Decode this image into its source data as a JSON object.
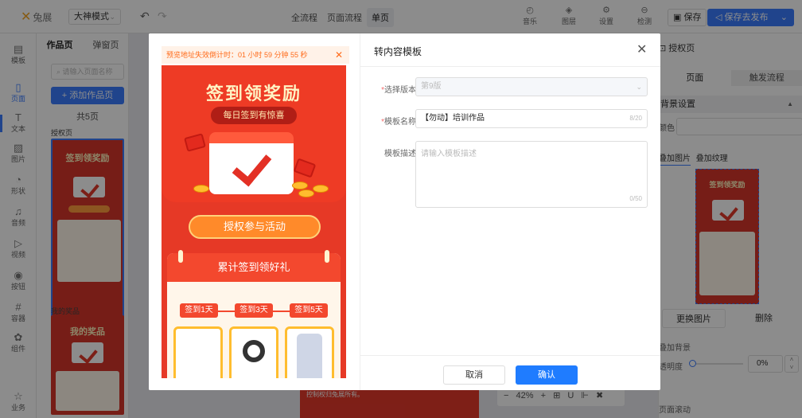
{
  "topbar": {
    "logo": "兔展",
    "mode": "大神模式",
    "flow_tabs": [
      "全流程",
      "页面流程",
      "单页"
    ],
    "tools": [
      {
        "icon": "music-icon",
        "label": "音乐"
      },
      {
        "icon": "layers-icon",
        "label": "图层"
      },
      {
        "icon": "settings-icon",
        "label": "设置"
      },
      {
        "icon": "check-icon",
        "label": "检测"
      }
    ],
    "save_label": "保存",
    "publish_label": "保存去发布"
  },
  "leftnav": {
    "items": [
      {
        "icon": "template-icon",
        "label": "模板"
      },
      {
        "icon": "page-icon",
        "label": "页面"
      },
      {
        "icon": "text-icon",
        "label": "文本"
      },
      {
        "icon": "image-icon",
        "label": "图片"
      },
      {
        "icon": "shape-icon",
        "label": "形状"
      },
      {
        "icon": "audio-icon",
        "label": "音频"
      },
      {
        "icon": "video-icon",
        "label": "视频"
      },
      {
        "icon": "button-icon",
        "label": "按钮"
      },
      {
        "icon": "container-icon",
        "label": "容器"
      },
      {
        "icon": "component-icon",
        "label": "组件"
      },
      {
        "icon": "business-icon",
        "label": "业务"
      }
    ]
  },
  "pages_panel": {
    "tabs": [
      "作品页",
      "弹窗页"
    ],
    "search_placeholder": "请输入页面名称",
    "add_label": "+ 添加作品页",
    "count": "共5页",
    "page1_label": "授权页",
    "page1_title": "签到领奖励",
    "page2_label": "我的奖品",
    "page2_title": "我的奖品"
  },
  "right_panel": {
    "title": "授权页",
    "tabs": [
      "页面",
      "触发流程"
    ],
    "section": "背景设置",
    "color_label": "颜色",
    "img_tabs": [
      "叠加图片",
      "叠加纹理"
    ],
    "preview_title": "签到领奖励",
    "replace": "更换图片",
    "delete": "删除",
    "overlay_bg": "叠加背景",
    "opacity_label": "透明度",
    "opacity": "0%",
    "page_scroll": "页面滚动"
  },
  "canvas": {
    "zoom": "42%",
    "footer_text": "控制权归兔展所有。"
  },
  "modal": {
    "countdown": "预览地址失效倒计时：01 小时 59 分钟 55 秒",
    "title": "转内容模板",
    "preview": {
      "title": "签到领奖励",
      "subtitle": "每日签到有惊喜",
      "auth_button": "授权参与活动",
      "acc_title": "累计签到领好礼",
      "days": [
        "签到1天",
        "签到3天",
        "签到5天"
      ]
    },
    "form": {
      "version_label": "选择版本",
      "version_value": "第9版",
      "name_label": "模板名称",
      "name_value": "【勿动】培训作品",
      "name_count": "8/20",
      "desc_label": "模板描述",
      "desc_placeholder": "请输入模板描述",
      "desc_count": "0/50"
    },
    "cancel_label": "取消",
    "confirm_label": "确认"
  }
}
